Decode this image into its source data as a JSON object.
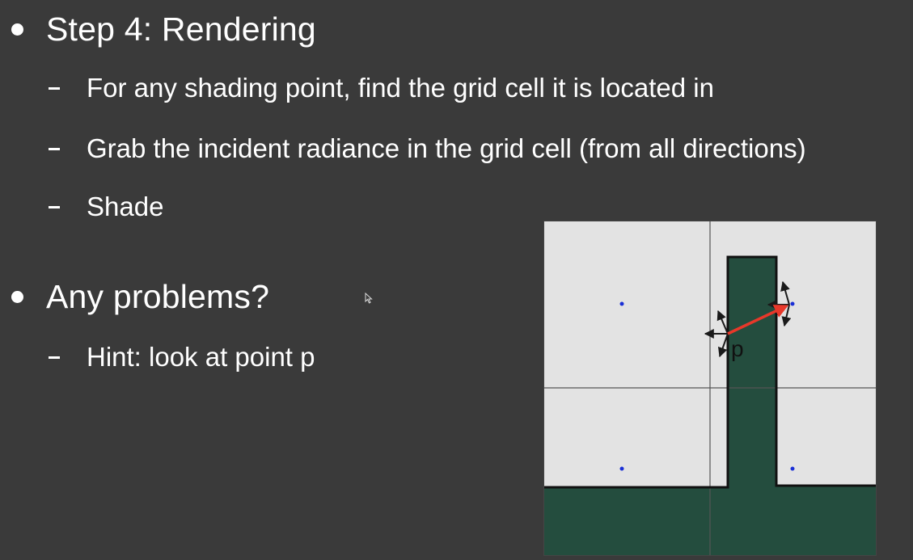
{
  "slide": {
    "bullets": [
      {
        "text": "Step 4: Rendering",
        "subs": [
          "For any shading point, find the grid cell it is located in",
          "Grab the incident radiance in the grid cell (from all directions)",
          "Shade"
        ]
      },
      {
        "text": "Any problems?",
        "subs": [
          "Hint: look at point p"
        ]
      }
    ]
  },
  "diagram": {
    "point_label": "p",
    "colors": {
      "background": "#3a3a3a",
      "cell_fill": "#e3e3e3",
      "solid_fill": "#244d3e",
      "grid_line": "#555555",
      "outline": "#111111",
      "cell_center": "#1a2fd6",
      "ray": "#e8382a",
      "arrows": "#1a1a1a"
    }
  }
}
